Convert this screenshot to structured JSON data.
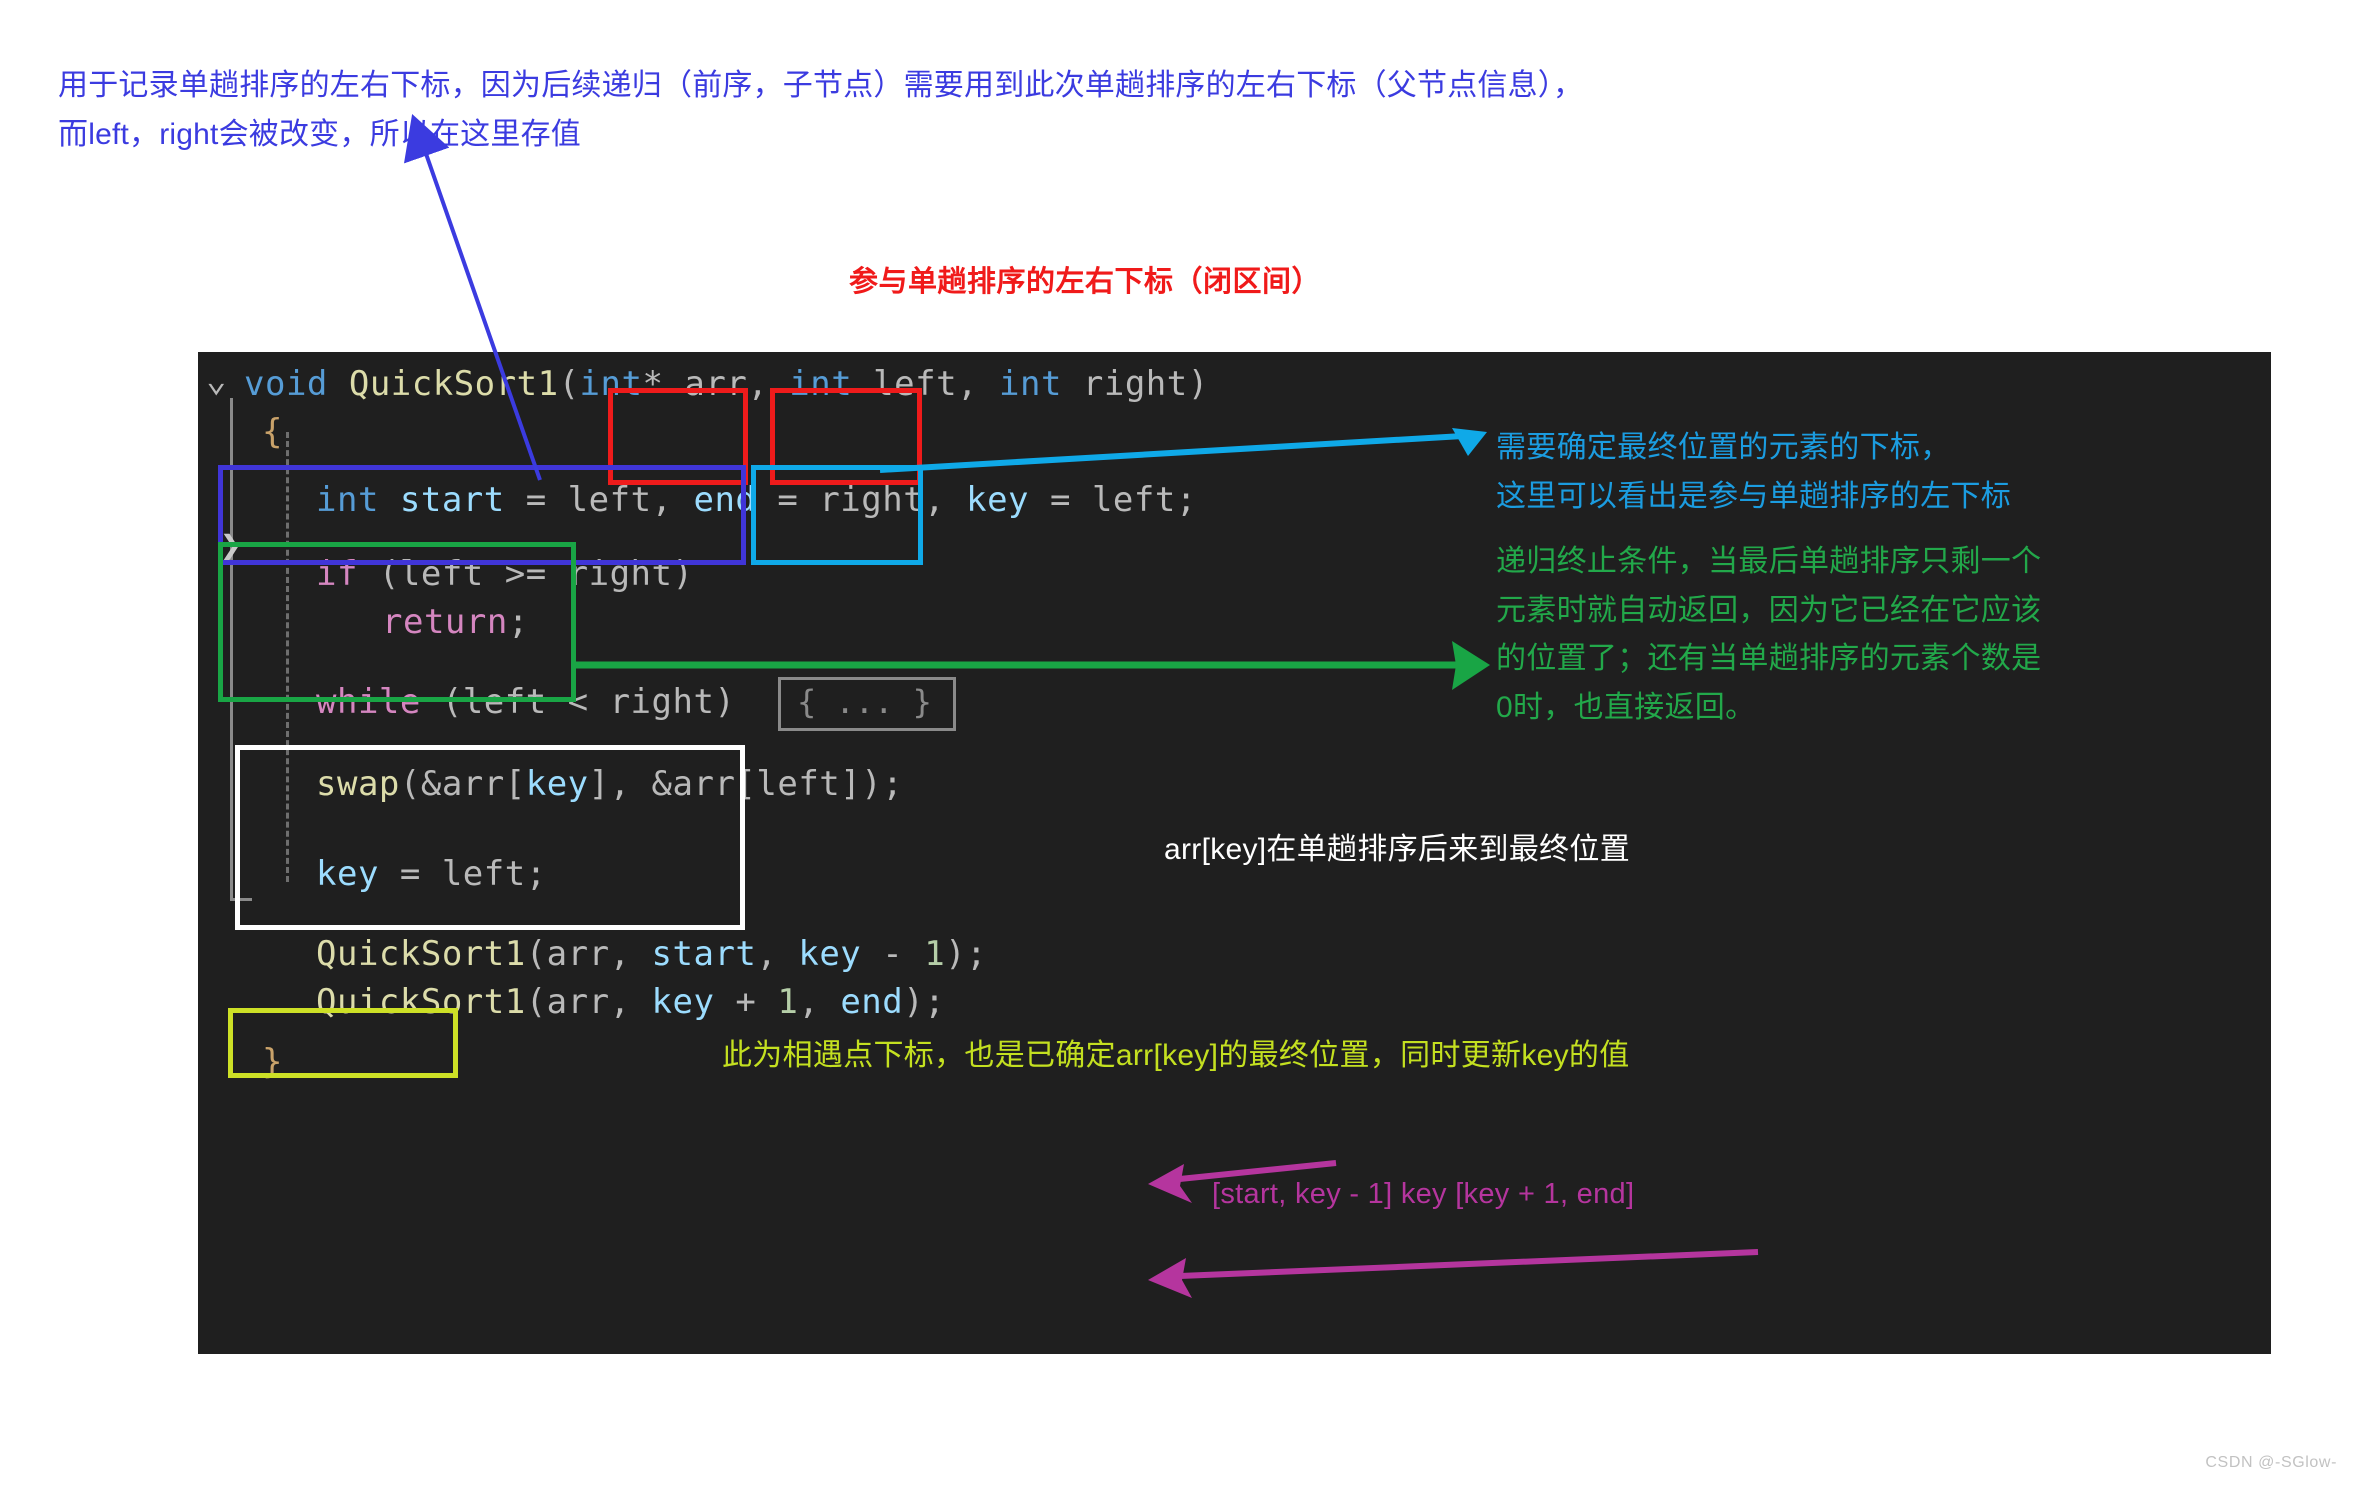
{
  "top_note": {
    "line1": "用于记录单趟排序的左右下标，因为后续递归（前序，子节点）需要用到此次单趟排序的左右下标（父节点信息），",
    "line2": "而left，right会被改变，所以在这里存值"
  },
  "red_caption": "参与单趟排序的左右下标（闭区间）",
  "code": {
    "line1": {
      "fold": "⌄",
      "t1": "void",
      "t2": " QuickSort1",
      "t3": "(",
      "t4": "int",
      "t5": "* arr, ",
      "t6": "int",
      "t7": " left",
      "t8": ", ",
      "t9": "int",
      "t10": " right",
      "t11": ")"
    },
    "line2": "{",
    "line3": {
      "t1": "int",
      "t2": " start",
      "t3": " = left, ",
      "t4": "end",
      "t5": " = right, ",
      "t6": "key",
      "t7": " = left",
      "t8": ";"
    },
    "line4": {
      "t1": "if",
      "t2": " (left >= right)"
    },
    "line5": {
      "t1": "return",
      "t2": ";"
    },
    "line6": {
      "t1": "while",
      "t2": " (left < right)",
      "collapsed": "{ ... }"
    },
    "line7": {
      "t1": "swap",
      "t2": "(&arr[",
      "t3": "key",
      "t4": "], &arr[left]);"
    },
    "line8": {
      "t1": "key",
      "t2": " = left;"
    },
    "line9": {
      "t1": "QuickSort1",
      "t2": "(arr, ",
      "t3": "start",
      "t4": ", ",
      "t5": "key",
      "t6": " - ",
      "t7": "1",
      "t8": ");"
    },
    "line10": {
      "t1": "QuickSort1",
      "t2": "(arr, ",
      "t3": "key",
      "t4": " + ",
      "t5": "1",
      "t6": ", ",
      "t7": "end",
      "t8": ");"
    },
    "line11": "}",
    "fold_arrow": "❯"
  },
  "annotations": {
    "cyan": "需要确定最终位置的元素的下标，\n这里可以看出是参与单趟排序的左下标",
    "green": "递归终止条件，当最后单趟排序只剩一个\n元素时就自动返回，因为它已经在它应该\n的位置了；还有当单趟排序的元素个数是\n0时，也直接返回。",
    "white": "arr[key]在单趟排序后来到最终位置",
    "yellow": "此为相遇点下标，也是已确定arr[key]的最终位置，同时更新key的值",
    "magenta": "[start, key - 1] key [key + 1, end]"
  },
  "colors": {
    "blue_note": "#3b3be0",
    "red": "#ee1b1b",
    "cyan": "#0fa9e8",
    "green": "#19a545",
    "white": "#ffffff",
    "yellow": "#cde026",
    "magenta": "#b5359e",
    "code_bg": "#1f1f1f"
  },
  "watermark": "CSDN @-SGlow-"
}
